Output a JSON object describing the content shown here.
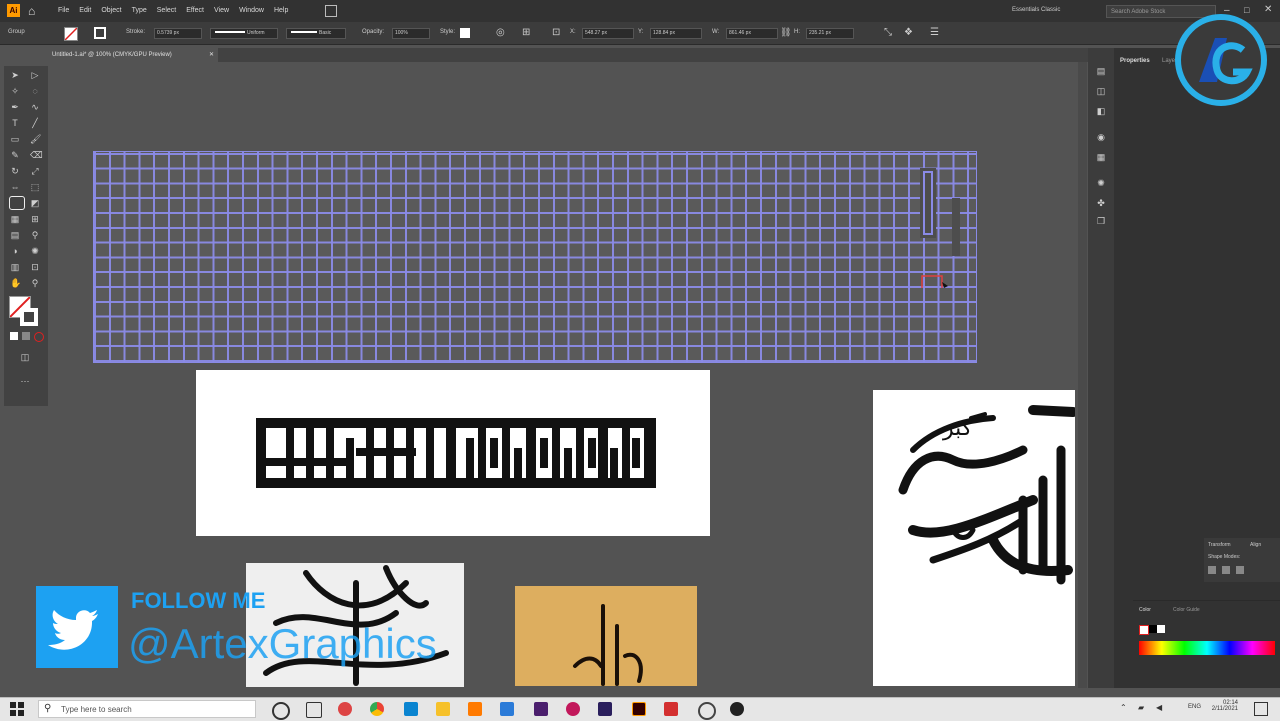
{
  "menubar": {
    "items": [
      "File",
      "Edit",
      "Object",
      "Type",
      "Select",
      "Effect",
      "View",
      "Window",
      "Help"
    ],
    "workspace": "Essentials Classic",
    "search_placeholder": "Search Adobe Stock"
  },
  "control_bar": {
    "selection_label": "Group",
    "stroke_label": "Stroke:",
    "stroke_value": "0.5739 px",
    "profile_1": "Uniform",
    "profile_2": "Basic",
    "opacity_label": "Opacity:",
    "opacity_value": "100%",
    "style_label": "Style:",
    "x_label": "X:",
    "x_value": "548.27 px",
    "y_label": "Y:",
    "y_value": "128.84 px",
    "w_label": "W:",
    "w_value": "861.46 px",
    "h_label": "H:",
    "h_value": "235.21 px"
  },
  "document_tab": {
    "title": "Untitled-1.ai* @ 100% (CMYK/GPU Preview)"
  },
  "right_panel": {
    "properties_tab": "Properties",
    "layers_tab": "Layers",
    "transform_tab": "Transform",
    "align_tab": "Align",
    "shape_modes": "Shape Modes:",
    "color_tab": "Color",
    "color_guide_tab": "Color Guide"
  },
  "canvas": {
    "kufic_text": "لا اله الا الله محمد رسول الله",
    "allahu_akbar_text": "الله أكبر",
    "bottom_left_text": "ماشاء الله",
    "bottom_mid_text": "الله"
  },
  "overlay": {
    "follow_label": "FOLLOW ME",
    "handle": "@ArtexGraphics",
    "logo_text": "AG"
  },
  "taskbar": {
    "search_placeholder": "Type here to search",
    "lang": "ENG",
    "time": "02:14",
    "date": "2/11/2021"
  },
  "colors": {
    "accent": "#1da1f2",
    "grid": "#8a8ae6",
    "app_bg": "#535353"
  }
}
